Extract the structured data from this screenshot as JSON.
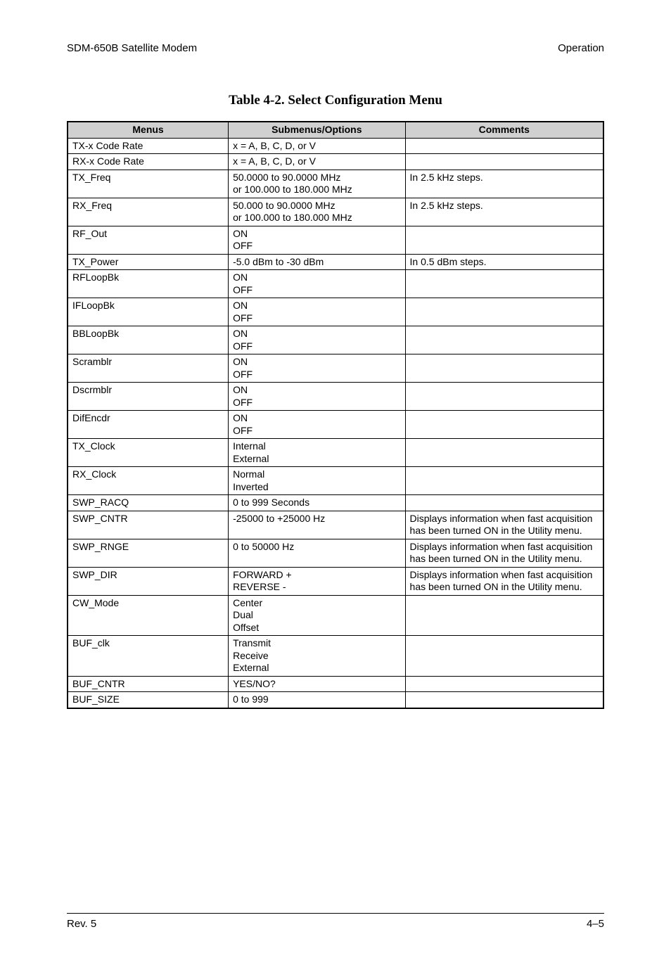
{
  "header": {
    "left": "SDM-650B Satellite Modem",
    "right": "Operation"
  },
  "title": "Table 4-2.  Select Configuration Menu",
  "columns": {
    "c1": "Menus",
    "c2": "Submenus/Options",
    "c3": "Comments"
  },
  "rows": [
    {
      "menu": "TX-x Code Rate",
      "sub": "x = A, B, C, D, or V",
      "comment": ""
    },
    {
      "menu": "RX-x Code Rate",
      "sub": "x = A, B, C, D, or V",
      "comment": ""
    },
    {
      "menu": "TX_Freq",
      "sub": "50.0000 to 90.0000 MHz\nor 100.000 to 180.000 MHz",
      "comment": "In 2.5 kHz steps."
    },
    {
      "menu": "RX_Freq",
      "sub": "50.000 to 90.0000 MHz\nor 100.000 to 180.000 MHz",
      "comment": "In 2.5 kHz steps."
    },
    {
      "menu": "RF_Out",
      "sub": "ON\nOFF",
      "comment": ""
    },
    {
      "menu": "TX_Power",
      "sub": "-5.0 dBm to -30 dBm",
      "comment": "In 0.5 dBm steps."
    },
    {
      "menu": "RFLoopBk",
      "sub": "ON\nOFF",
      "comment": ""
    },
    {
      "menu": "IFLoopBk",
      "sub": "ON\nOFF",
      "comment": ""
    },
    {
      "menu": "BBLoopBk",
      "sub": "ON\nOFF",
      "comment": ""
    },
    {
      "menu": "Scramblr",
      "sub": "ON\nOFF",
      "comment": ""
    },
    {
      "menu": "Dscrmblr",
      "sub": "ON\nOFF",
      "comment": ""
    },
    {
      "menu": "DifEncdr",
      "sub": "ON\nOFF",
      "comment": ""
    },
    {
      "menu": "TX_Clock",
      "sub": "Internal\nExternal",
      "comment": ""
    },
    {
      "menu": "RX_Clock",
      "sub": "Normal\nInverted",
      "comment": ""
    },
    {
      "menu": "SWP_RACQ",
      "sub": "0 to 999 Seconds",
      "comment": ""
    },
    {
      "menu": "SWP_CNTR",
      "sub": "-25000 to +25000 Hz",
      "comment": "Displays information when fast acquisition has been turned ON in the Utility menu."
    },
    {
      "menu": "SWP_RNGE",
      "sub": "0 to 50000 Hz",
      "comment": "Displays information when fast acquisition has been turned ON in the Utility menu."
    },
    {
      "menu": "SWP_DIR",
      "sub": "FORWARD +\nREVERSE -",
      "comment": "Displays information when fast acquisition has been turned ON in the Utility menu."
    },
    {
      "menu": "CW_Mode",
      "sub": "Center\nDual\nOffset",
      "comment": ""
    },
    {
      "menu": "BUF_clk",
      "sub": "Transmit\nReceive\nExternal",
      "comment": ""
    },
    {
      "menu": "BUF_CNTR",
      "sub": "YES/NO?",
      "comment": ""
    },
    {
      "menu": "BUF_SIZE",
      "sub": "0 to 999",
      "comment": ""
    }
  ],
  "footer": {
    "left": "Rev. 5",
    "right": "4–5"
  }
}
